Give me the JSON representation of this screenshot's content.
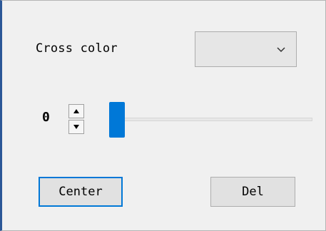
{
  "cross_color": {
    "label": "Cross color",
    "dropdown_value": "",
    "chevron_icon": "chevron-down-icon"
  },
  "spinner": {
    "value": "0",
    "up_icon": "arrow-up-icon",
    "down_icon": "arrow-down-icon"
  },
  "slider": {
    "value_fraction": 0
  },
  "buttons": {
    "center_label": "Center",
    "del_label": "Del"
  },
  "colors": {
    "accent": "#0078d7",
    "panel_background": "#f0f0f0",
    "left_border": "#2b5797"
  }
}
